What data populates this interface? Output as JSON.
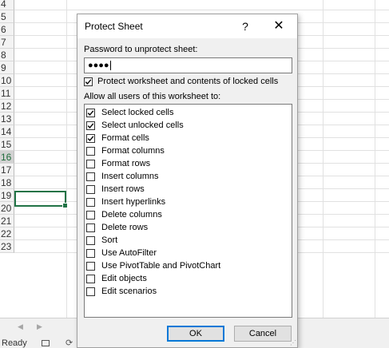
{
  "sheet": {
    "row_numbers": [
      "4",
      "5",
      "6",
      "7",
      "8",
      "9",
      "10",
      "11",
      "12",
      "13",
      "14",
      "15",
      "16",
      "17",
      "18",
      "19",
      "20",
      "21",
      "22",
      "23"
    ],
    "active_row": "16"
  },
  "status": {
    "text": "Ready"
  },
  "dialog": {
    "title": "Protect Sheet",
    "help_label": "?",
    "close_label": "✕",
    "password_label": "Password to unprotect sheet:",
    "password_value": "●●●●",
    "protect_label": "Protect worksheet and contents of locked cells",
    "protect_checked": true,
    "allow_label": "Allow all users of this worksheet to:",
    "permissions": [
      {
        "label": "Select locked cells",
        "checked": true
      },
      {
        "label": "Select unlocked cells",
        "checked": true
      },
      {
        "label": "Format cells",
        "checked": true
      },
      {
        "label": "Format columns",
        "checked": false
      },
      {
        "label": "Format rows",
        "checked": false
      },
      {
        "label": "Insert columns",
        "checked": false
      },
      {
        "label": "Insert rows",
        "checked": false
      },
      {
        "label": "Insert hyperlinks",
        "checked": false
      },
      {
        "label": "Delete columns",
        "checked": false
      },
      {
        "label": "Delete rows",
        "checked": false
      },
      {
        "label": "Sort",
        "checked": false
      },
      {
        "label": "Use AutoFilter",
        "checked": false
      },
      {
        "label": "Use PivotTable and PivotChart",
        "checked": false
      },
      {
        "label": "Edit objects",
        "checked": false
      },
      {
        "label": "Edit scenarios",
        "checked": false
      }
    ],
    "ok_label": "OK",
    "cancel_label": "Cancel"
  },
  "colors": {
    "accent": "#217346",
    "focus": "#0078d7"
  },
  "icons": [
    "help-icon",
    "close-icon",
    "checkbox-checked-icon",
    "checkbox-unchecked-icon",
    "resize-grip-icon"
  ]
}
